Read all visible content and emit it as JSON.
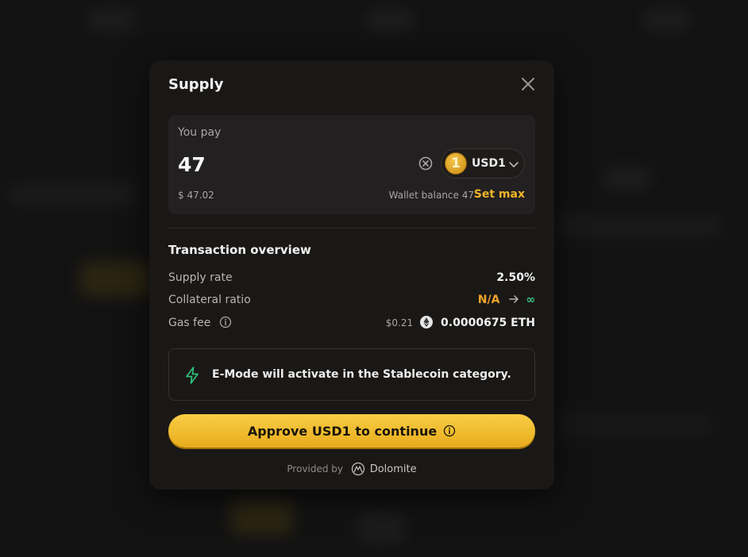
{
  "modal": {
    "title": "Supply"
  },
  "pay": {
    "label": "You pay",
    "amount": "47",
    "usd_value": "$ 47.02",
    "wallet_balance": "Wallet balance 47",
    "set_max_label": "Set max",
    "token": {
      "symbol": "USD1",
      "logo_glyph": "1",
      "logo_color": "#e8a91c"
    }
  },
  "overview": {
    "title": "Transaction overview",
    "supply_rate": {
      "label": "Supply rate",
      "value": "2.50%"
    },
    "collateral_ratio": {
      "label": "Collateral ratio",
      "from": "N/A",
      "to": "∞"
    },
    "gas_fee": {
      "label": "Gas fee",
      "usd": "$0.21",
      "amount": "0.0000675 ETH"
    }
  },
  "emode": {
    "message": "E-Mode will activate in the Stablecoin category."
  },
  "approve_button": {
    "label": "Approve USD1 to continue"
  },
  "footer": {
    "provided_by": "Provided by",
    "provider_name": "Dolomite"
  },
  "colors": {
    "accent": "#f0b429",
    "na": "#f0a52a",
    "infinity": "#3ec88a",
    "emode_icon": "#2fbf7a"
  }
}
